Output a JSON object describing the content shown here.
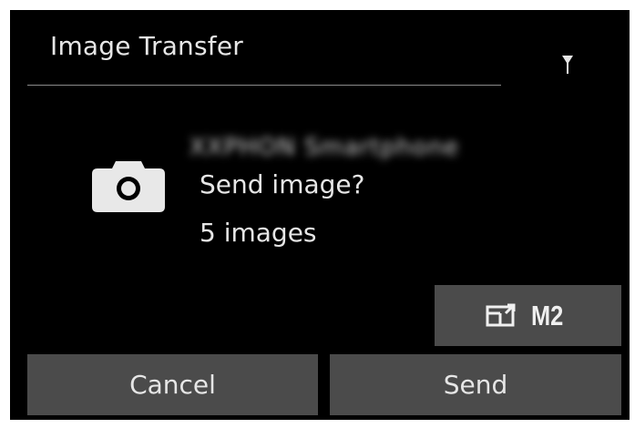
{
  "dialog": {
    "title": "Image Transfer",
    "device_name": "XXPHON Smartphone",
    "prompt": "Send image?",
    "count": "5 images"
  },
  "icons": {
    "signal": "antenna-icon",
    "camera": "camera-icon",
    "settings": "resize-image-icon"
  },
  "setting_button": {
    "label": "M2"
  },
  "buttons": {
    "cancel": "Cancel",
    "send": "Send"
  },
  "colors": {
    "background": "#000000",
    "button": "#4b4b4b",
    "text": "#e6e6e6"
  }
}
